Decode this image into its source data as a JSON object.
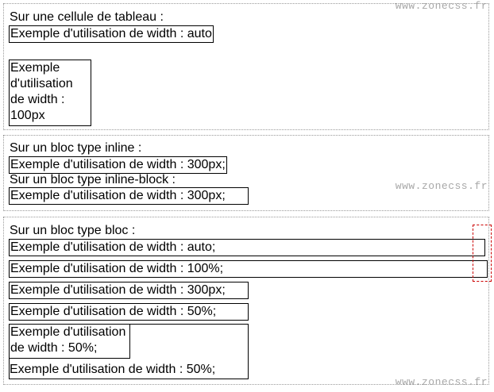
{
  "watermark": "www.zonecss.fr",
  "section_table": {
    "heading": "Sur une cellule de tableau :",
    "cell_auto": "Exemple d'utilisation de width : auto",
    "cell_100px": "Exemple d'utilisation de width : 100px",
    "cell_100px_lines": [
      "Exemple",
      "d'utilisation",
      "de width :",
      "100px"
    ]
  },
  "section_inline": {
    "heading_inline": "Sur un bloc type inline :",
    "inline_300px": "Exemple d'utilisation de width : 300px;",
    "heading_inline_block": "Sur un bloc type inline-block :",
    "inline_block_300px": "Exemple d'utilisation de width : 300px;"
  },
  "section_block": {
    "heading": "Sur un bloc type bloc :",
    "block_auto": "Exemple d'utilisation de width : auto;",
    "block_100pct": "Exemple d'utilisation de width : 100%;",
    "block_300px": "Exemple d'utilisation de width : 300px;",
    "block_50pct": "Exemple d'utilisation de width : 50%;",
    "nested_inner_lines": [
      "Exemple d'utilisation",
      "de width : 50%;"
    ],
    "nested_outer": "Exemple d'utilisation de width : 50%;"
  }
}
